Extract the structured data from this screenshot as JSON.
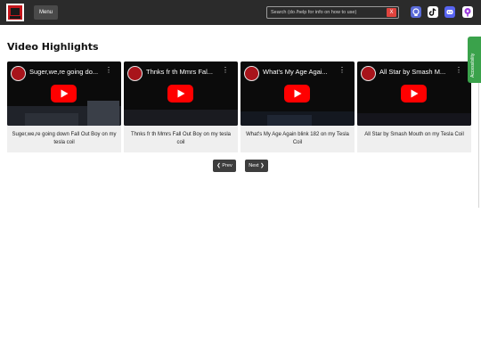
{
  "header": {
    "menu_label": "Menu",
    "search_placeholder": "Search (do /help for info on how to use)",
    "clear_label": "X",
    "social_icons": [
      "github-icon",
      "tiktok-icon",
      "discord-icon",
      "podcast-icon"
    ]
  },
  "accessibility_tab": "Accessibility",
  "section_title": "Video Highlights",
  "videos": [
    {
      "title": "Suger,we,re going do...",
      "caption": "Suger,we,re going down Fall Out Boy on my tesla coil"
    },
    {
      "title": "Thnks fr th Mmrs Fal...",
      "caption": "Thnks fr th Mmrs Fall Out Boy on my tesla coil"
    },
    {
      "title": "What's My Age Agai...",
      "caption": "What's My Age Again blink 182 on my Tesla Coil"
    },
    {
      "title": "All Star by Smash M...",
      "caption": "All Star by Smash Mouth on my Tesla Coil"
    }
  ],
  "pagination": {
    "prev_label": "❮ Prev",
    "next_label": "Next ❯"
  },
  "colors": {
    "topbar": "#2b2b2b",
    "youtube_red": "#ff0000",
    "accessibility_green": "#3aa24b",
    "clear_red": "#e0443e"
  }
}
